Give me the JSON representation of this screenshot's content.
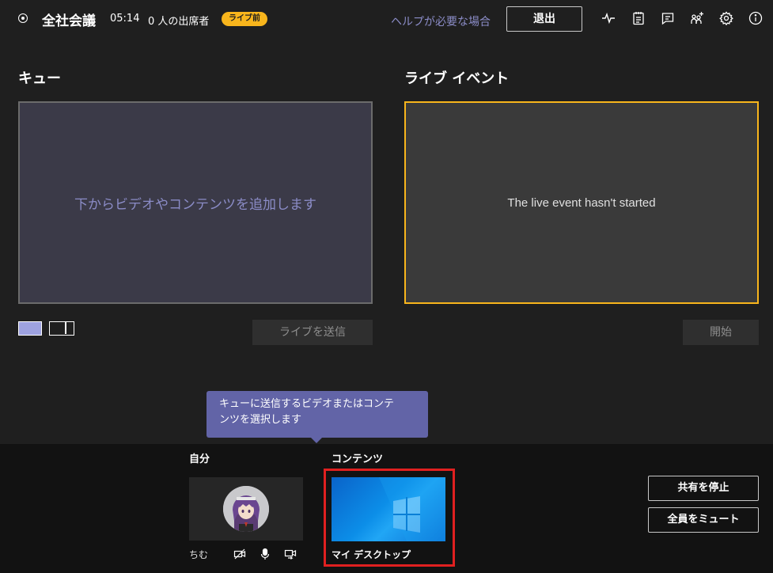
{
  "header": {
    "title": "全社会議",
    "timer": "05:14",
    "attendees": "0 人の出席者",
    "status_badge": "ライブ前",
    "help_link": "ヘルプが必要な場合",
    "exit_button": "退出",
    "icons": [
      "health-icon",
      "notes-icon",
      "chat-icon",
      "participants-add-icon",
      "settings-icon",
      "info-icon"
    ]
  },
  "queue": {
    "title": "キュー",
    "placeholder": "下からビデオやコンテンツを追加します",
    "send_live_button": "ライブを送信"
  },
  "live_event": {
    "title": "ライブ イベント",
    "status_text": "The live event hasn't started",
    "start_button": "開始"
  },
  "tooltip": {
    "line1": "キューに送信するビデオまたはコンテ",
    "line2": "ンツを選択します"
  },
  "tray": {
    "self_label": "自分",
    "self_name": "ちむ",
    "content_label": "コンテンツ",
    "desktop_label": "マイ デスクトップ",
    "stop_sharing_button": "共有を停止",
    "mute_all_button": "全員をミュート"
  },
  "colors": {
    "accent_purple": "#6264a7",
    "live_border": "#f8b51c",
    "selected_frame": "#e02020"
  }
}
